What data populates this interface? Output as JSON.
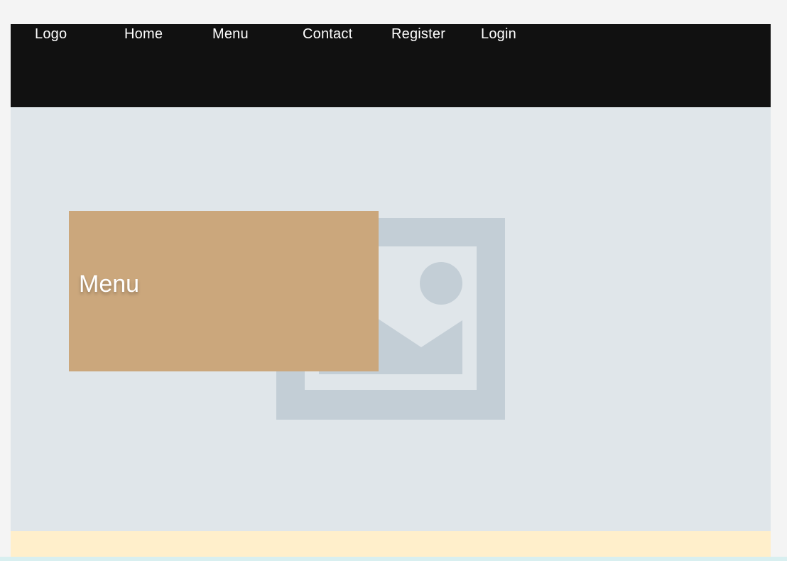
{
  "navbar": {
    "logo": "Logo",
    "items": [
      {
        "label": "Home"
      },
      {
        "label": "Menu"
      },
      {
        "label": "Contact"
      },
      {
        "label": "Register"
      },
      {
        "label": "Login"
      }
    ]
  },
  "hero": {
    "image_icon": "image-placeholder-icon",
    "card": {
      "title": "Menu"
    }
  },
  "colors": {
    "page_background": "#f4f4f4",
    "navbar_background": "#111111",
    "hero_background": "#e0e6ea",
    "image_placeholder": "#c3ced6",
    "card_background": "#cba77c",
    "footer_band": "#ffefcb",
    "bottom_strip": "#d8eff0",
    "text_light": "#ffffff"
  }
}
